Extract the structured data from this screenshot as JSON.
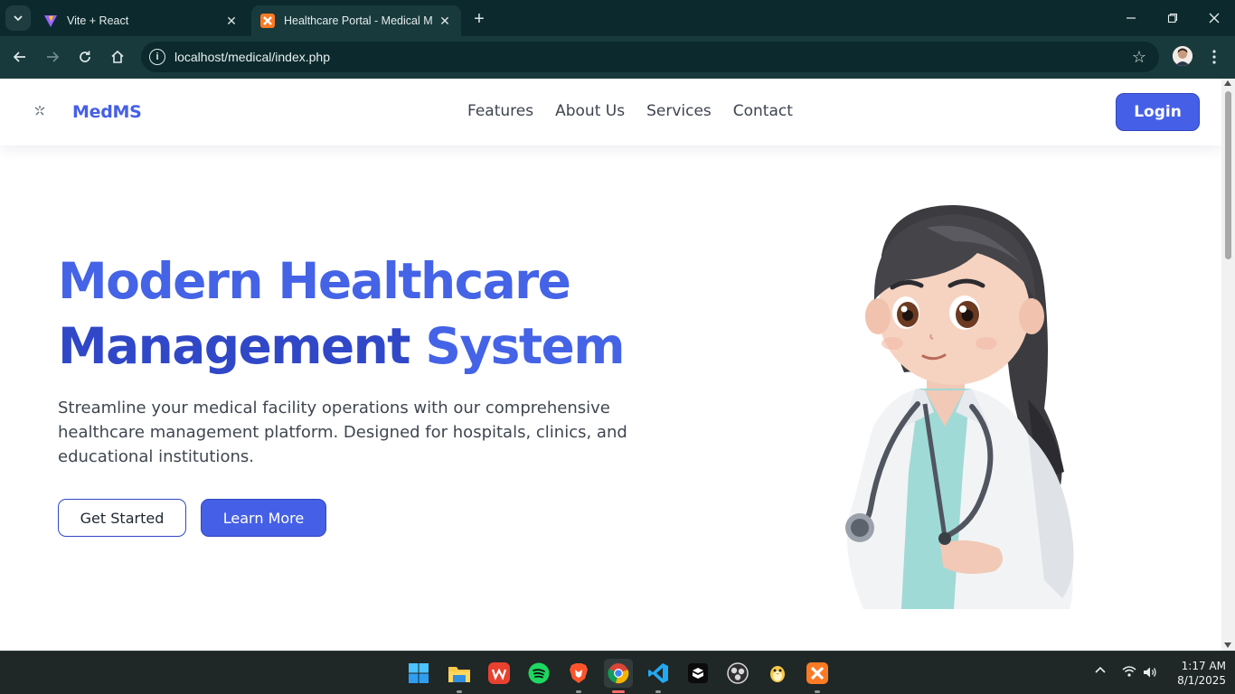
{
  "browser": {
    "tabs": [
      {
        "title": "Vite + React",
        "icon": "vite-icon",
        "active": false
      },
      {
        "title": "Healthcare Portal - Medical Management",
        "icon": "xampp-icon",
        "active": true
      }
    ],
    "url": "localhost/medical/index.php"
  },
  "site": {
    "brand": "MedMS",
    "nav": [
      "Features",
      "About Us",
      "Services",
      "Contact"
    ],
    "login": "Login"
  },
  "hero": {
    "title_part1": "Modern Healthcare",
    "title_part2": "Management",
    "title_part3": "System",
    "description": "Streamline your medical facility operations with our comprehensive healthcare management platform. Designed for hospitals, clinics, and educational institutions.",
    "primary_cta": "Get Started",
    "secondary_cta": "Learn More"
  },
  "colors": {
    "brand": "#4560e6",
    "brand_dark": "#3048c7",
    "chrome": "#193a3d"
  },
  "taskbar": {
    "apps": [
      "windows-start-icon",
      "file-explorer-icon",
      "wps-office-icon",
      "spotify-icon",
      "brave-icon",
      "chrome-icon",
      "vscode-icon",
      "cube-app-icon",
      "obs-icon",
      "penguin-app-icon",
      "xampp-icon"
    ],
    "time": "1:17 AM",
    "date": "8/1/2025"
  }
}
